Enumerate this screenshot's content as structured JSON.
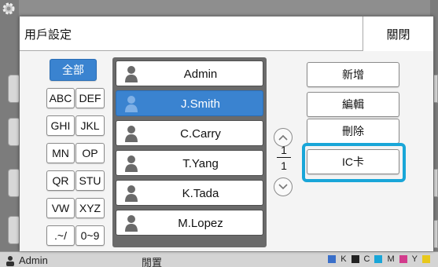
{
  "dialog": {
    "title": "用戶設定",
    "close_label": "關閉"
  },
  "filters": {
    "all": "全部",
    "abc": "ABC",
    "def": "DEF",
    "ghi": "GHI",
    "jkl": "JKL",
    "mn": "MN",
    "op": "OP",
    "qr": "QR",
    "stu": "STU",
    "vw": "VW",
    "xyz": "XYZ",
    "symbols": ".~/",
    "digits": "0~9"
  },
  "users": [
    {
      "name": "Admin",
      "selected": false
    },
    {
      "name": "J.Smith",
      "selected": true
    },
    {
      "name": "C.Carry",
      "selected": false
    },
    {
      "name": "T.Yang",
      "selected": false
    },
    {
      "name": "K.Tada",
      "selected": false
    },
    {
      "name": "M.Lopez",
      "selected": false
    }
  ],
  "pager": {
    "current": "1",
    "total": "1"
  },
  "actions": {
    "add": "新增",
    "edit": "編輯",
    "delete": "刪除",
    "ic_card": "IC卡"
  },
  "status_bar": {
    "user": "Admin",
    "center": "閒置",
    "ink_labels": [
      "K",
      "C",
      "M",
      "Y"
    ]
  },
  "colors": {
    "accent": "#3a83d0",
    "highlight": "#19a6d8"
  }
}
